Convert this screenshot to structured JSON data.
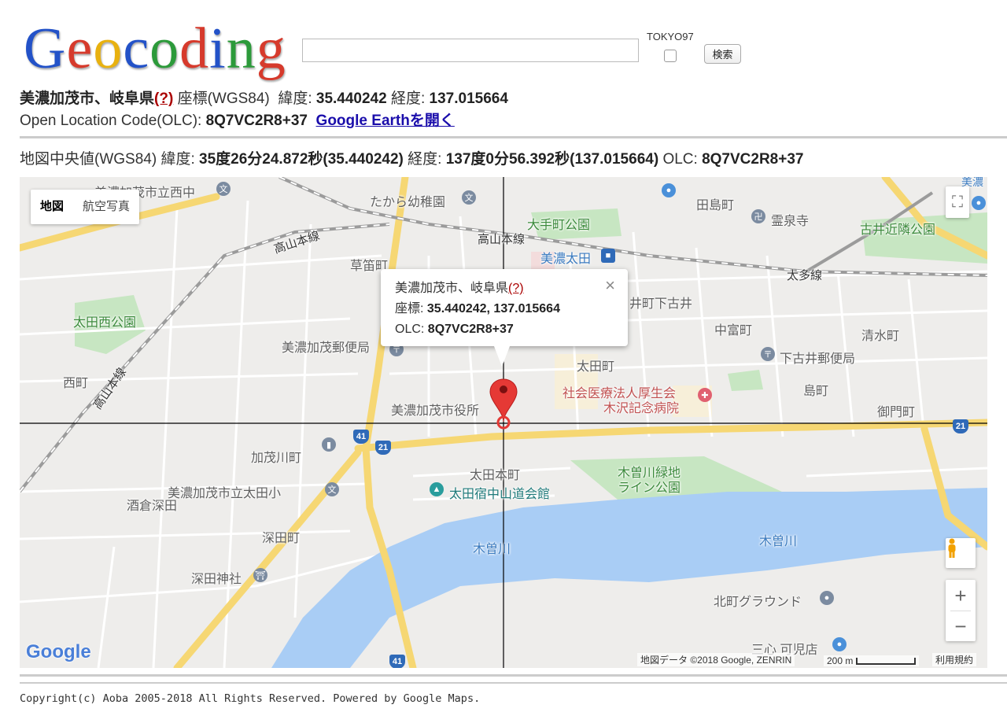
{
  "logo": {
    "letters": [
      "G",
      "e",
      "o",
      "c",
      "o",
      "d",
      "i",
      "n",
      "g"
    ],
    "colors": [
      "#2352c8",
      "#d63a2c",
      "#e8b10f",
      "#2352c8",
      "#2c9a3a",
      "#d63a2c",
      "#2352c8",
      "#2c9a3a",
      "#d63a2c"
    ]
  },
  "search": {
    "value": "",
    "placeholder": ""
  },
  "tokyo_label": "TOKYO97",
  "search_button": "検索",
  "info": {
    "address": "美濃加茂市、岐阜県",
    "help": "(?)",
    "coord_label": "座標(WGS84)",
    "lat_label": "緯度:",
    "lat": "35.440242",
    "lng_label": "経度:",
    "lng": "137.015664",
    "olc_label": "Open Location Code(OLC):",
    "olc": "8Q7VC2R8+37",
    "earth_link": "Google Earthを開く"
  },
  "center": {
    "label": "地図中央値(WGS84)",
    "lat_label": "緯度:",
    "lat": "35度26分24.872秒(35.440242)",
    "lng_label": "経度:",
    "lng": "137度0分56.392秒(137.015664)",
    "olc_label": "OLC:",
    "olc": "8Q7VC2R8+37"
  },
  "map": {
    "type_buttons": [
      "地図",
      "航空写真"
    ],
    "popup": {
      "address": "美濃加茂市、岐阜県",
      "help": "(?)",
      "coord_label": "座標:",
      "coord": "35.440242, 137.015664",
      "olc_label": "OLC:",
      "olc": "8Q7VC2R8+37",
      "close": "×"
    },
    "labels": {
      "school_nishinaka": "美濃加茂市立西中",
      "takara": "たから幼稚園",
      "tajimacho": "田島町",
      "reisenji": "霊泉寺",
      "furui_park": "古井近隣公園",
      "otemachi_park": "大手町公園",
      "takayama_line_1": "高山本線",
      "takayama_line_2": "高山本線",
      "takayama_line_3": "高山本線",
      "minoota": "美濃太田",
      "kusabuecho": "草笛町",
      "taita_line": "太多線",
      "shimofurui": "井町下古井",
      "ota_nishi_park": "太田西公園",
      "nakatomicho": "中富町",
      "shimizucho": "清水町",
      "post_office": "美濃加茂郵便局",
      "shimofurui_post": "下古井郵便局",
      "otamachi": "太田町",
      "kousei_1": "社会医療法人厚生会",
      "kousei_2": "木沢記念病院",
      "nishimachi": "西町",
      "shimamachi": "島町",
      "city_hall": "美濃加茂市役所",
      "gomoncho": "御門町",
      "kamokawacho": "加茂川町",
      "otahonmachi": "太田本町",
      "kisogawa_park_1": "木曽川緑地",
      "kisogawa_park_2": "ライン公園",
      "ota_school": "美濃加茂市立太田小",
      "nakasendo": "太田宿中山道会館",
      "sakakurafukada": "酒倉深田",
      "fukadacho": "深田町",
      "kisogawa_1": "木曽川",
      "kisogawa_2": "木曽川",
      "fukada_shrine": "深田神社",
      "kitamachi_ground": "北町グラウンド",
      "sanshin": "三心 可児店",
      "route_41": "41",
      "route_21": "21",
      "route_21b": "21",
      "route_41b": "41",
      "minoo_edge": "美濃"
    },
    "attribution": "地図データ ©2018 Google, ZENRIN",
    "scale": "200 m",
    "terms": "利用規約",
    "google_logo": "Google",
    "zoom_in": "+",
    "zoom_out": "−"
  },
  "footer": "Copyright(c) Aoba 2005-2018 All Rights Reserved. Powered by Google Maps."
}
